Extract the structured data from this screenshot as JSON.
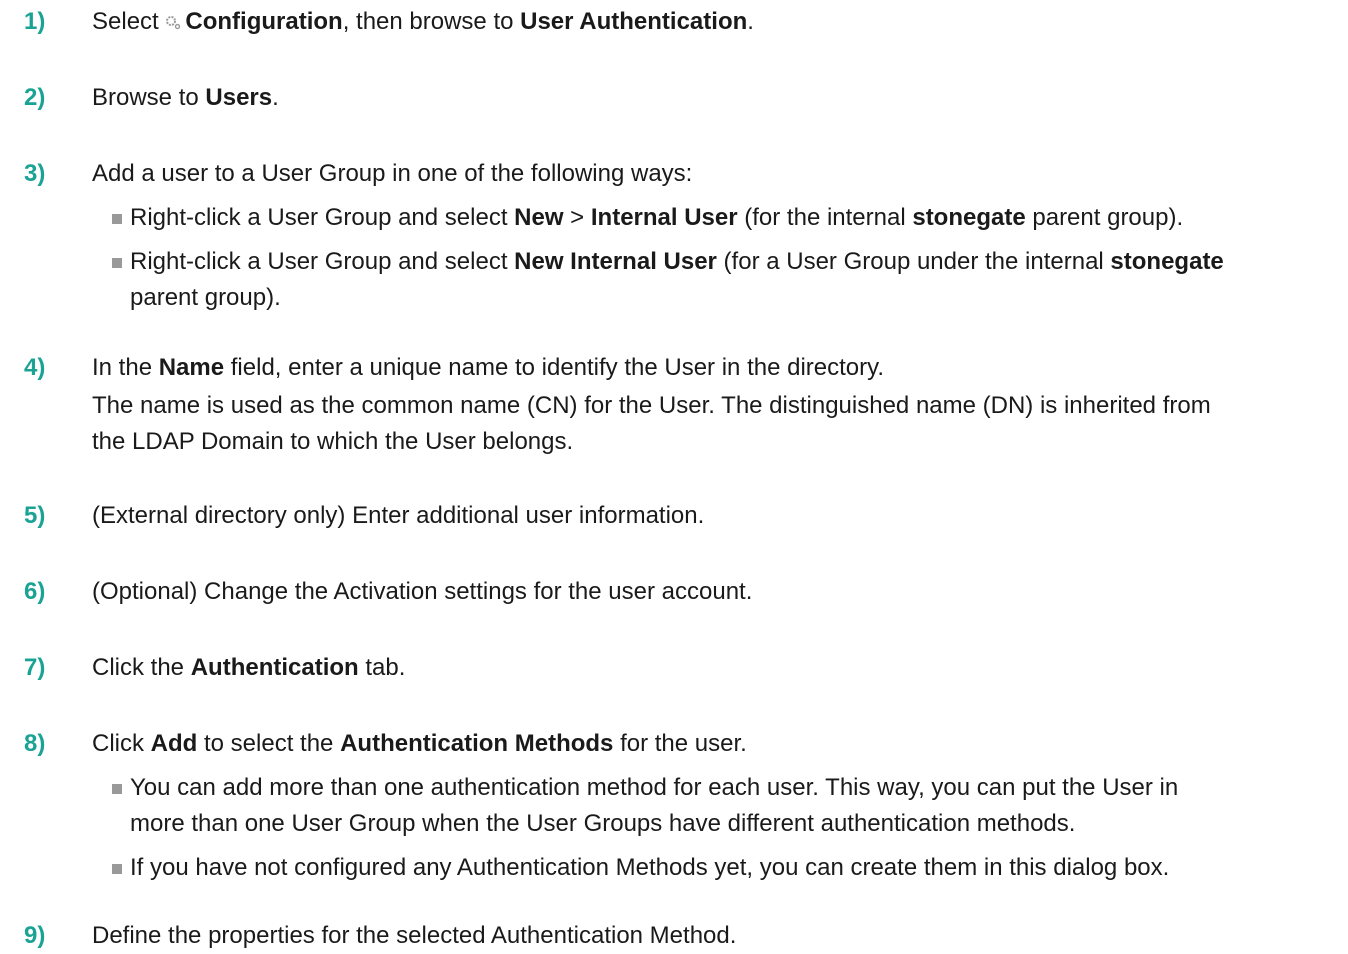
{
  "steps": [
    {
      "num": "1)",
      "parts": [
        {
          "t": "Select "
        },
        {
          "icon": "gear-icon"
        },
        {
          "t": "Configuration",
          "b": true
        },
        {
          "t": ", then browse to "
        },
        {
          "t": "User Authentication",
          "b": true
        },
        {
          "t": "."
        }
      ]
    },
    {
      "num": "2)",
      "parts": [
        {
          "t": "Browse to "
        },
        {
          "t": "Users",
          "b": true
        },
        {
          "t": "."
        }
      ]
    },
    {
      "num": "3)",
      "parts": [
        {
          "t": "Add a user to a User Group in one of the following ways:"
        }
      ],
      "bullets": [
        [
          [
            {
              "t": "Right-click a User Group and select "
            },
            {
              "t": "New",
              "b": true
            },
            {
              "t": " > "
            },
            {
              "t": "Internal User",
              "b": true
            },
            {
              "t": " (for the internal "
            },
            {
              "t": "stonegate",
              "b": true
            },
            {
              "t": " parent group)."
            }
          ]
        ],
        [
          [
            {
              "t": "Right-click a User Group and select "
            },
            {
              "t": "New Internal User",
              "b": true
            },
            {
              "t": " (for a User Group under the internal "
            },
            {
              "t": "stonegate",
              "b": true
            }
          ],
          [
            {
              "t": "parent group)."
            }
          ]
        ]
      ]
    },
    {
      "num": "4)",
      "parts": [
        {
          "t": "In the "
        },
        {
          "t": "Name",
          "b": true
        },
        {
          "t": " field, enter a unique name to identify the User in the directory."
        }
      ],
      "extra": [
        "The name is used as the common name (CN) for the User. The distinguished name (DN) is inherited from",
        "the LDAP Domain to which the User belongs."
      ]
    },
    {
      "num": "5)",
      "parts": [
        {
          "t": "(External directory only) Enter additional user information."
        }
      ]
    },
    {
      "num": "6)",
      "parts": [
        {
          "t": "(Optional) Change the Activation settings for the user account."
        }
      ]
    },
    {
      "num": "7)",
      "parts": [
        {
          "t": "Click the "
        },
        {
          "t": "Authentication",
          "b": true
        },
        {
          "t": " tab."
        }
      ]
    },
    {
      "num": "8)",
      "parts": [
        {
          "t": "Click "
        },
        {
          "t": "Add",
          "b": true
        },
        {
          "t": " to select the "
        },
        {
          "t": "Authentication Methods",
          "b": true
        },
        {
          "t": " for the user."
        }
      ],
      "bullets": [
        [
          [
            {
              "t": "You can add more than one authentication method for each user. This way, you can put the User in"
            }
          ],
          [
            {
              "t": "more than one User Group when the User Groups have different authentication methods."
            }
          ]
        ],
        [
          [
            {
              "t": "If you have not configured any Authentication Methods yet, you can create them in this dialog box."
            }
          ]
        ]
      ]
    },
    {
      "num": "9)",
      "parts": [
        {
          "t": "Define the properties for the selected Authentication Method."
        }
      ]
    }
  ],
  "colors": {
    "number": "#1aa394",
    "bullet": "#999999",
    "text": "#1a1a1a"
  }
}
